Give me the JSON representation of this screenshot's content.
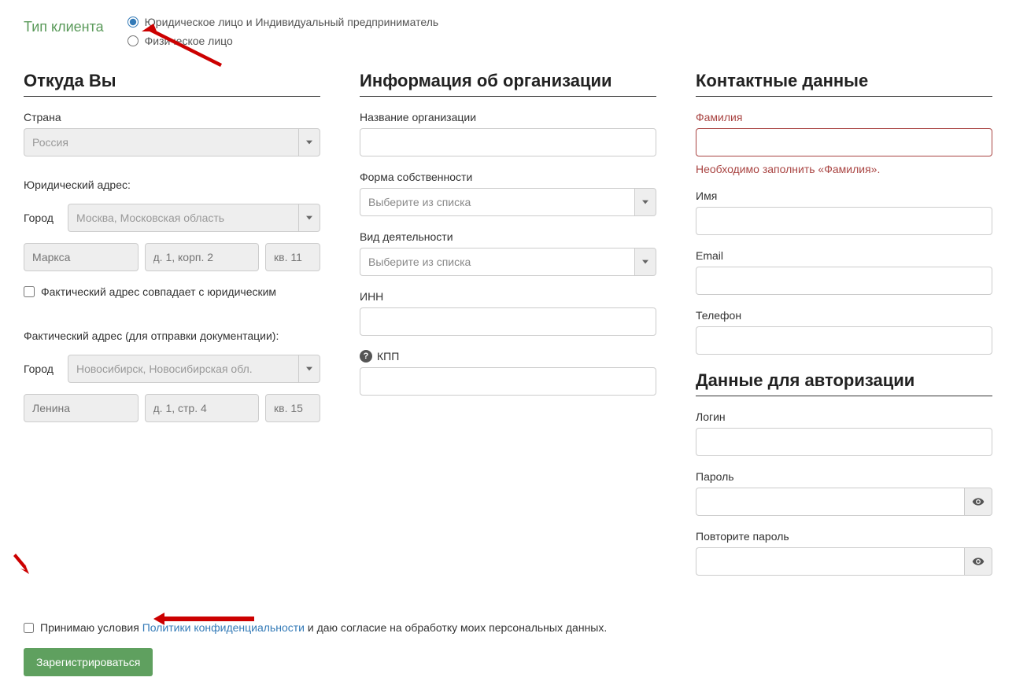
{
  "clientType": {
    "label": "Тип клиента",
    "option1": "Юридическое лицо и Индивидуальный предприниматель",
    "option2": "Физическое лицо"
  },
  "location": {
    "title": "Откуда Вы",
    "countryLabel": "Страна",
    "countryValue": "Россия",
    "legalAddressLabel": "Юридический адрес:",
    "cityLabel": "Город",
    "legalCity": "Москва, Московская область",
    "legalStreet": "Маркса",
    "legalBuilding": "д. 1, корп. 2",
    "legalApt": "кв. 11",
    "sameAddressLabel": "Фактический адрес совпадает с юридическим",
    "actualAddressLabel": "Фактический адрес (для отправки документации):",
    "actualCity": "Новосибирск, Новосибирская обл.",
    "actualStreet": "Ленина",
    "actualBuilding": "д. 1, стр. 4",
    "actualApt": "кв. 15"
  },
  "org": {
    "title": "Информация об организации",
    "nameLabel": "Название организации",
    "ownershipLabel": "Форма собственности",
    "selectPlaceholder": "Выберите из списка",
    "activityLabel": "Вид деятельности",
    "innLabel": "ИНН",
    "kppLabel": "КПП"
  },
  "contact": {
    "title": "Контактные данные",
    "surnameLabel": "Фамилия",
    "surnameError": "Необходимо заполнить «Фамилия».",
    "nameLabel": "Имя",
    "emailLabel": "Email",
    "phoneLabel": "Телефон"
  },
  "auth": {
    "title": "Данные для авторизации",
    "loginLabel": "Логин",
    "passwordLabel": "Пароль",
    "repeatPasswordLabel": "Повторите пароль"
  },
  "consent": {
    "prefix": "Принимаю условия ",
    "link": "Политики конфиденциальности",
    "suffix": " и даю согласие на обработку моих персональных данных."
  },
  "submitLabel": "Зарегистрироваться"
}
